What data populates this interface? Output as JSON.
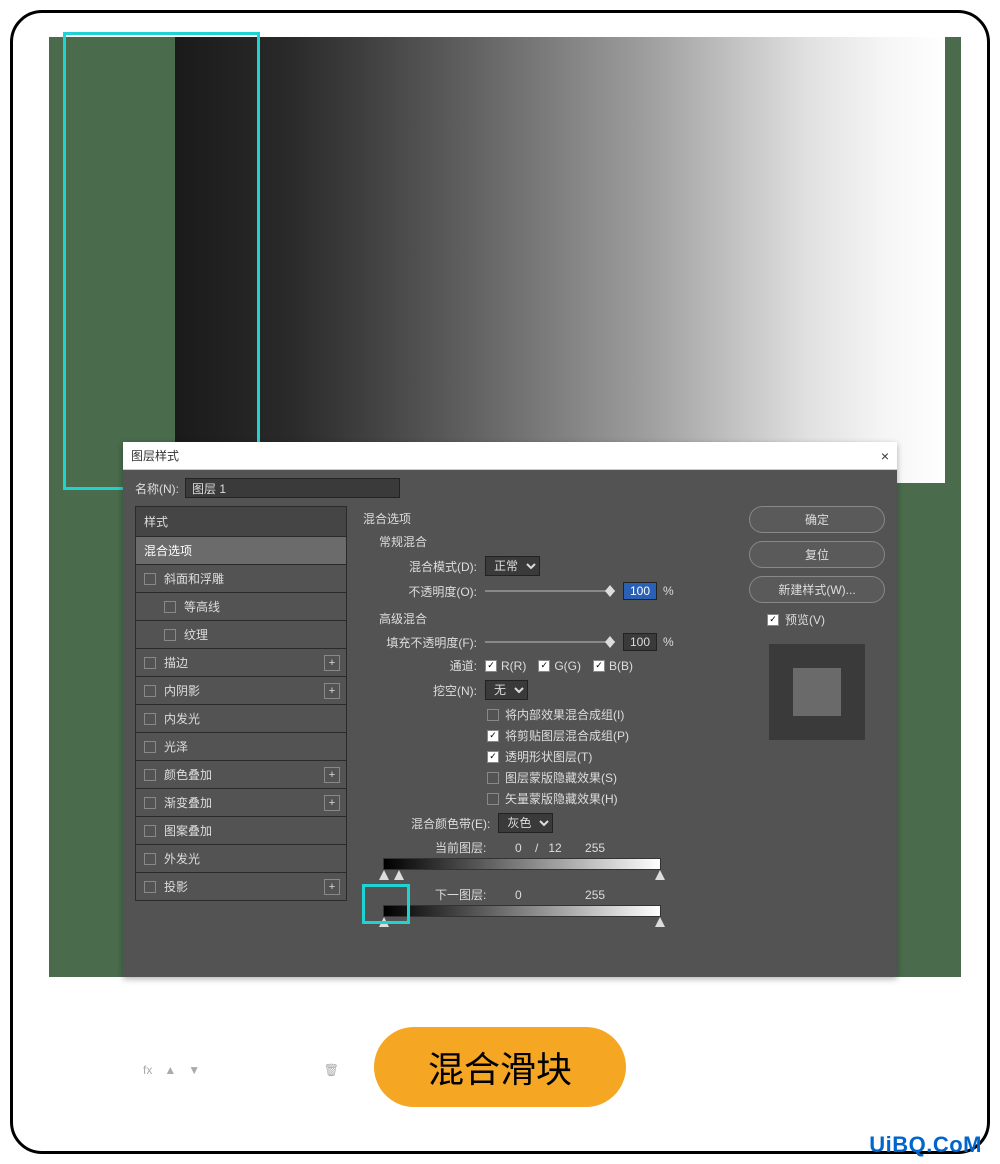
{
  "dialog": {
    "title": "图层样式",
    "close_icon": "×",
    "name_label": "名称(N):",
    "name_value": "图层 1"
  },
  "styles": {
    "header": "样式",
    "items": [
      {
        "label": "混合选项",
        "has_checkbox": false,
        "selected": true
      },
      {
        "label": "斜面和浮雕",
        "has_checkbox": true
      },
      {
        "label": "等高线",
        "has_checkbox": true,
        "sub": true
      },
      {
        "label": "纹理",
        "has_checkbox": true,
        "sub": true
      },
      {
        "label": "描边",
        "has_checkbox": true,
        "plus": true
      },
      {
        "label": "内阴影",
        "has_checkbox": true,
        "plus": true
      },
      {
        "label": "内发光",
        "has_checkbox": true
      },
      {
        "label": "光泽",
        "has_checkbox": true
      },
      {
        "label": "颜色叠加",
        "has_checkbox": true,
        "plus": true
      },
      {
        "label": "渐变叠加",
        "has_checkbox": true,
        "plus": true
      },
      {
        "label": "图案叠加",
        "has_checkbox": true
      },
      {
        "label": "外发光",
        "has_checkbox": true
      },
      {
        "label": "投影",
        "has_checkbox": true,
        "plus": true
      }
    ],
    "footer_fx": "fx",
    "footer_trash": "🗑"
  },
  "main": {
    "section_title": "混合选项",
    "general_title": "常规混合",
    "blend_mode_label": "混合模式(D):",
    "blend_mode_value": "正常",
    "opacity_label": "不透明度(O):",
    "opacity_value": "100",
    "percent": "%",
    "advanced_title": "高级混合",
    "fill_opacity_label": "填充不透明度(F):",
    "fill_opacity_value": "100",
    "channels_label": "通道:",
    "channel_r": "R(R)",
    "channel_g": "G(G)",
    "channel_b": "B(B)",
    "knockout_label": "挖空(N):",
    "knockout_value": "无",
    "options": [
      {
        "label": "将内部效果混合成组(I)",
        "checked": false
      },
      {
        "label": "将剪贴图层混合成组(P)",
        "checked": true
      },
      {
        "label": "透明形状图层(T)",
        "checked": true
      },
      {
        "label": "图层蒙版隐藏效果(S)",
        "checked": false
      },
      {
        "label": "矢量蒙版隐藏效果(H)",
        "checked": false
      }
    ],
    "blend_if_label": "混合颜色带(E):",
    "blend_if_value": "灰色",
    "this_layer_label": "当前图层:",
    "this_layer_vals": "0    /   12       255",
    "under_layer_label": "下一图层:",
    "under_layer_vals": "0                   255"
  },
  "right": {
    "ok": "确定",
    "cancel": "复位",
    "new_style": "新建样式(W)...",
    "preview": "预览(V)"
  },
  "caption": "混合滑块",
  "watermark": "UiBQ.CoM"
}
